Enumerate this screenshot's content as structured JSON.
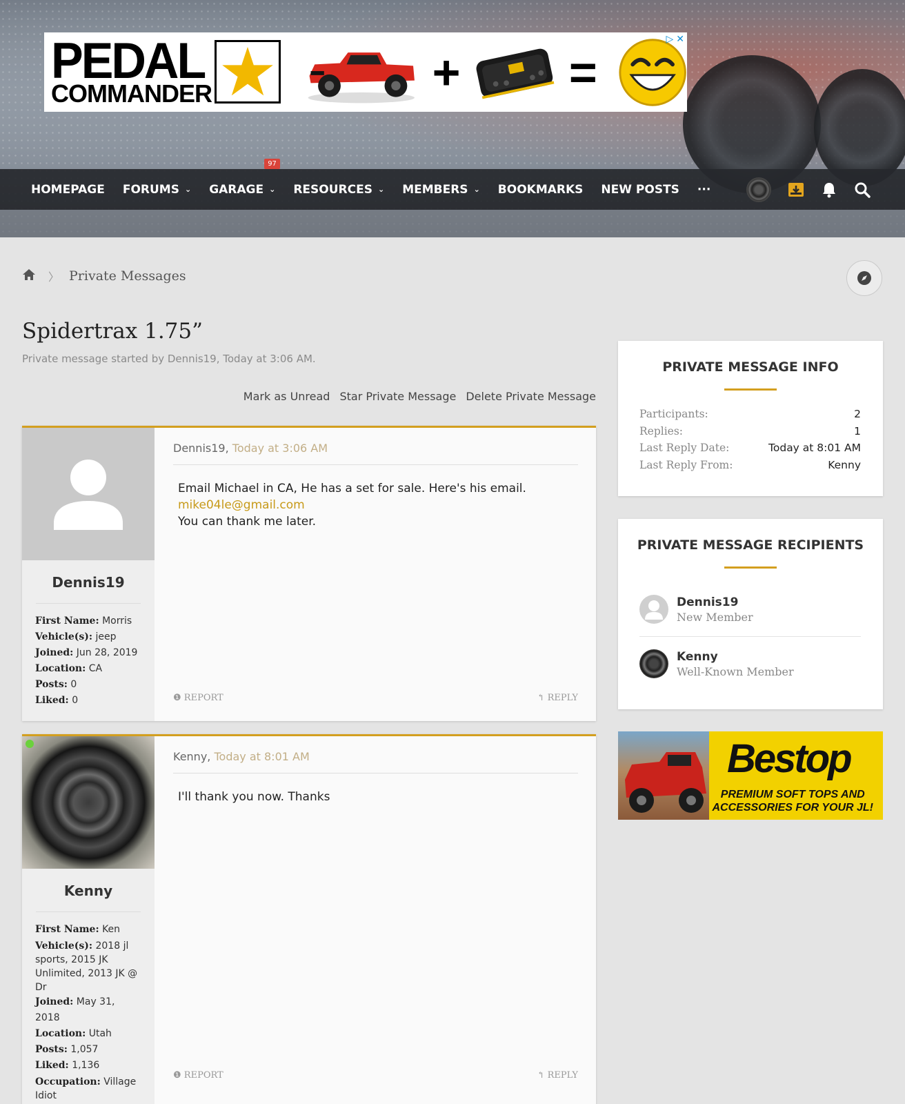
{
  "ad_top": {
    "brand_line1": "PEDAL",
    "brand_line2": "COMMANDER",
    "plus": "+",
    "equals": "="
  },
  "nav": {
    "items": [
      {
        "label": "HOMEPAGE",
        "dropdown": false
      },
      {
        "label": "FORUMS",
        "dropdown": true
      },
      {
        "label": "GARAGE",
        "dropdown": true
      },
      {
        "label": "RESOURCES",
        "dropdown": true
      },
      {
        "label": "MEMBERS",
        "dropdown": true
      },
      {
        "label": "BOOKMARKS",
        "dropdown": false
      },
      {
        "label": "NEW POSTS",
        "dropdown": false
      },
      {
        "label": "···",
        "dropdown": false
      }
    ],
    "garage_badge": "97",
    "icons": [
      "avatar",
      "inbox-icon",
      "bell-icon",
      "search-icon"
    ],
    "accent_color": "#d39f1f"
  },
  "breadcrumb": {
    "home_icon": "home-icon",
    "label": "Private Messages"
  },
  "title": "Spidertrax 1.75”",
  "subtitle": "Private message started by Dennis19, Today at 3:06 AM.",
  "actions": [
    "Mark as Unread",
    "Star Private Message",
    "Delete Private Message"
  ],
  "messages": [
    {
      "author": "Dennis19",
      "time": "Today at 3:06 AM",
      "fields": [
        {
          "k": "First Name:",
          "v": "Morris"
        },
        {
          "k": "Vehicle(s):",
          "v": "jeep"
        },
        {
          "k": "Joined:",
          "v": "Jun 28, 2019"
        },
        {
          "k": "Location:",
          "v": "CA"
        },
        {
          "k": "Posts:",
          "v": "0"
        },
        {
          "k": "Liked:",
          "v": "0"
        }
      ],
      "body_line1": "Email Michael in CA, He has a set for sale. Here's his email.",
      "body_link": "mike04le@gmail.com",
      "body_line2": "You can thank me later.",
      "report": "REPORT",
      "reply": "REPLY"
    },
    {
      "author": "Kenny",
      "time": "Today at 8:01 AM",
      "fields": [
        {
          "k": "First Name:",
          "v": "Ken"
        },
        {
          "k": "Vehicle(s):",
          "v": "2018 jl sports, 2015 JK Unlimited, 2013 JK @ Dr"
        },
        {
          "k": "Joined:",
          "v": "May 31, 2018"
        },
        {
          "k": "Location:",
          "v": "Utah"
        },
        {
          "k": "Posts:",
          "v": "1,057"
        },
        {
          "k": "Liked:",
          "v": "1,136"
        },
        {
          "k": "Occupation:",
          "v": "Village Idiot"
        }
      ],
      "body_line1": "I'll thank you now. Thanks",
      "report": "REPORT",
      "reply": "REPLY"
    }
  ],
  "sidebar": {
    "info_title": "PRIVATE MESSAGE INFO",
    "info": [
      {
        "k": "Participants:",
        "v": "2"
      },
      {
        "k": "Replies:",
        "v": "1"
      },
      {
        "k": "Last Reply Date:",
        "v": "Today at 8:01 AM"
      },
      {
        "k": "Last Reply From:",
        "v": "Kenny"
      }
    ],
    "recipients_title": "PRIVATE MESSAGE RECIPIENTS",
    "recipients": [
      {
        "name": "Dennis19",
        "role": "New Member"
      },
      {
        "name": "Kenny",
        "role": "Well-Known Member"
      }
    ]
  },
  "ad_side": {
    "logo": "Bestop",
    "tag_line1": "PREMIUM SOFT TOPS AND",
    "tag_line2": "ACCESSORIES FOR YOUR JL!"
  }
}
